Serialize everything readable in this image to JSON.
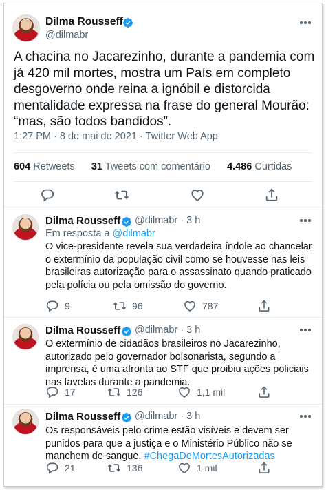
{
  "main": {
    "author": "Dilma Rousseff",
    "handle": "@dilmabr",
    "text": "A chacina no Jacarezinho, durante a pandemia com já 420 mil mortes, mostra um País em completo desgoverno onde reina a ignóbil e distorcida mentalidade expressa na frase do general Mourão: “mas, são todos bandidos”.",
    "timestamp": "1:27 PM · 8 de mai de 2021 · Twitter Web App",
    "stats": {
      "retweets_count": "604",
      "retweets_label": "Retweets",
      "comments_count": "31",
      "comments_label": "Tweets com comentário",
      "likes_count": "4.486",
      "likes_label": "Curtidas"
    }
  },
  "replies": [
    {
      "author": "Dilma Rousseff",
      "handle": "@dilmabr",
      "time": "· 3 h",
      "reply_to_label": "Em resposta a",
      "reply_to_handle": "@dilmabr",
      "text": "O vice-presidente revela sua verdadeira índole ao chancelar o extermínio da população civil como se houvesse nas leis brasileiras autorização para o assassinato quando praticado pela polícia ou pela omissão do governo.",
      "replies": "9",
      "retweets": "96",
      "likes": "787"
    },
    {
      "author": "Dilma Rousseff",
      "handle": "@dilmabr",
      "time": "· 3 h",
      "text": "O extermínio de cidadãos brasileiros no Jacarezinho, autorizado pelo governador bolsonarista, segundo a imprensa, é uma afronta ao STF que proibiu ações policiais nas favelas durante a pandemia.",
      "replies": "17",
      "retweets": "126",
      "likes": "1,1 mil"
    },
    {
      "author": "Dilma Rousseff",
      "handle": "@dilmabr",
      "time": "· 3 h",
      "text": "Os responsáveis pelo crime estão visíveis e devem ser punidos para que a justiça e o Ministério Público não se manchem de sangue.",
      "hashtag": "#ChegaDeMortesAutorizadas",
      "replies": "21",
      "retweets": "136",
      "likes": "1 mil"
    }
  ],
  "icons": {
    "verified": "verified-badge-icon",
    "more": "more-options-icon",
    "reply": "reply-icon",
    "retweet": "retweet-icon",
    "like": "heart-icon",
    "share": "share-icon"
  },
  "colors": {
    "accent": "#1d9bf0",
    "text": "#0f1419",
    "secondary": "#536471"
  }
}
